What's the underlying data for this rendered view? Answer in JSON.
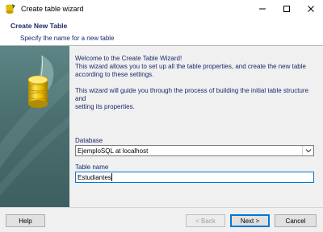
{
  "window": {
    "title": "Create table wizard",
    "icon": "database-cylinder-icon"
  },
  "header": {
    "title": "Create New Table",
    "subtitle": "Specify the name for a new table"
  },
  "welcome": {
    "line1": "Welcome to the Create Table Wizard!",
    "line2": "This wizard allows you to set up all the table properties, and create the new table",
    "line3": "according to these settings.",
    "line4": "This wizard will guide you through the process of building the initial table structure and",
    "line5": "setting its properties."
  },
  "database": {
    "label": "Database",
    "value": "EjemploSQL at localhost"
  },
  "table_name": {
    "label": "Table name",
    "value": "Estudiantes"
  },
  "buttons": {
    "help": "Help",
    "back": "< Back",
    "next": "Next >",
    "cancel": "Cancel"
  },
  "colors": {
    "accent": "#0078d7",
    "header_text": "#1a2a6c",
    "banner": "#4c7070",
    "cylinder": "#f2c500"
  }
}
